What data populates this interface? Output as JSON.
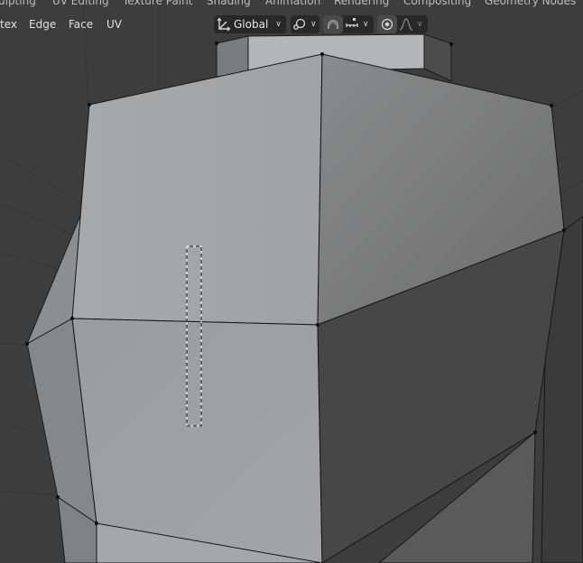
{
  "workspace_tabs": [
    "ulpting",
    "UV Editing",
    "Texture Paint",
    "Shading",
    "Animation",
    "Rendering",
    "Compositing",
    "Geometry Nodes"
  ],
  "header": {
    "menu": [
      "tex",
      "Edge",
      "Face",
      "UV"
    ],
    "orientation": {
      "label": "Global",
      "icon": "transform-orientation-icon"
    },
    "pivot": {
      "icon": "pivot-point-icon"
    },
    "snap": {
      "icon": "snap-magnet-icon",
      "target_icon": "snap-increment-icon"
    },
    "proportional": {
      "icon": "proportional-editing-icon",
      "falloff_icon": "falloff-curve-icon"
    }
  },
  "viewport": {
    "background": "#3d3d3d",
    "mesh_light": "#a2a4a6",
    "mesh_dark": "#474747",
    "box_select_active": true
  }
}
